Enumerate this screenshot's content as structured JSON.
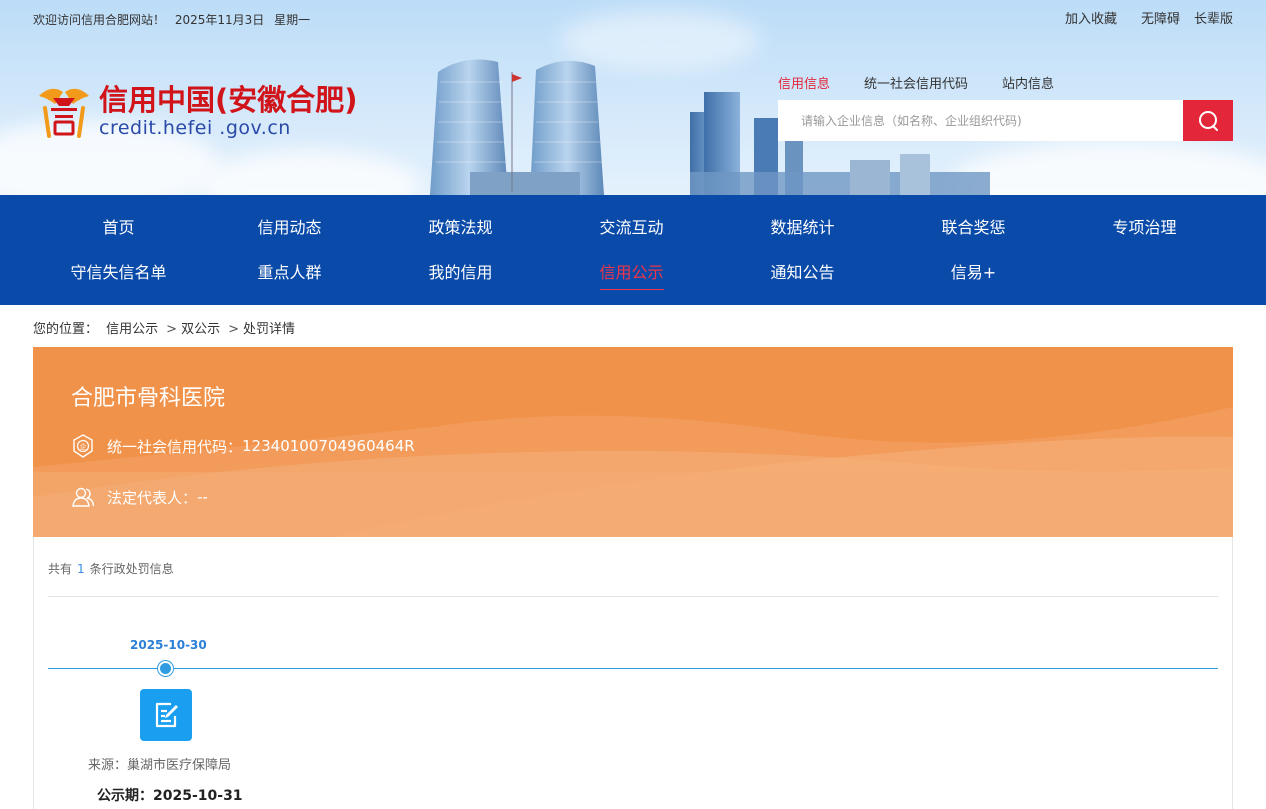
{
  "header": {
    "welcome": "欢迎访问信用合肥网站！",
    "date": "2025年11月3日",
    "weekday": "星期一",
    "links": [
      "加入收藏",
      "无障碍",
      "长辈版"
    ],
    "logo_cn": "信用中国(安徽合肥)",
    "logo_en": "credit.hefei .gov.cn",
    "logo_icon": "credit-seal-icon"
  },
  "search": {
    "tabs": [
      "信用信息",
      "统一社会信用代码",
      "站内信息"
    ],
    "active_tab": "信用信息",
    "placeholder": "请输入企业信息（如名称、企业组织代码)",
    "button_icon": "search-icon"
  },
  "nav": {
    "row1": [
      "首页",
      "信用动态",
      "政策法规",
      "交流互动",
      "数据统计",
      "联合奖惩",
      "专项治理"
    ],
    "row2": [
      "守信失信名单",
      "重点人群",
      "我的信用",
      "信用公示",
      "通知公告",
      "信易+"
    ],
    "active": "信用公示"
  },
  "breadcrumb": {
    "label": "您的位置：",
    "items": [
      "信用公示",
      "双公示",
      "处罚详情"
    ],
    "separator": ">"
  },
  "org": {
    "name": "合肥市骨科医院",
    "credit_code_label": "统一社会信用代码：",
    "credit_code": "12340100704960464R",
    "legal_rep_label": "法定代表人：",
    "legal_rep": "--"
  },
  "records": {
    "count_prefix": "共有",
    "count": "1",
    "count_suffix": "条行政处罚信息",
    "items": [
      {
        "date": "2025-10-30",
        "source_label": "来源：",
        "source": "巢湖市医疗保障局",
        "publish_label": "公示期：",
        "publish": "2025-10-31",
        "icon": "document-edit-icon"
      }
    ]
  },
  "colors": {
    "nav_bg": "#0a4aa8",
    "accent_red": "#e3263a",
    "banner_orange": "#f0924a",
    "timeline_blue": "#2f9be0"
  }
}
